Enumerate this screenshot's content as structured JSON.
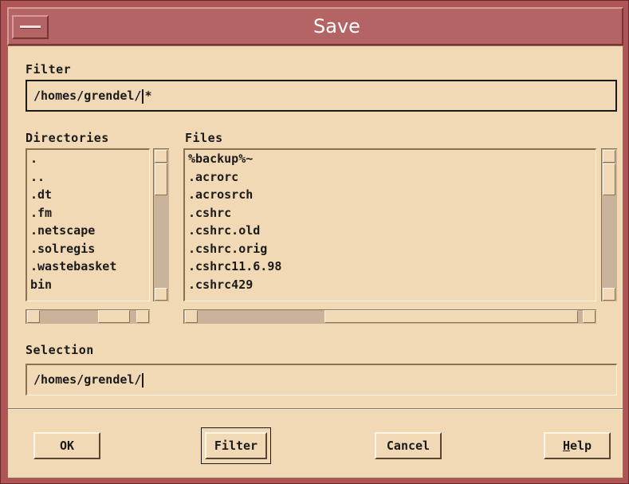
{
  "window": {
    "title": "Save"
  },
  "filter": {
    "label": "Filter",
    "value": "/homes/grendel/",
    "value_suffix": "*"
  },
  "directories": {
    "label": "Directories",
    "items": [
      ".",
      "..",
      ".dt",
      ".fm",
      ".netscape",
      ".solregis",
      ".wastebasket",
      "bin"
    ]
  },
  "files": {
    "label": "Files",
    "items": [
      "%backup%~",
      ".acrorc",
      ".acrosrch",
      ".cshrc",
      ".cshrc.old",
      ".cshrc.orig",
      ".cshrc11.6.98",
      ".cshrc429"
    ]
  },
  "selection": {
    "label": "Selection",
    "value": "/homes/grendel/"
  },
  "buttons": {
    "ok": "OK",
    "filter": "Filter",
    "cancel": "Cancel",
    "help_mnemonic": "H",
    "help_rest": "elp"
  },
  "colors": {
    "title_bar": "#b46464",
    "dialog_bg": "#f1d9b6",
    "frame": "#b05555"
  }
}
